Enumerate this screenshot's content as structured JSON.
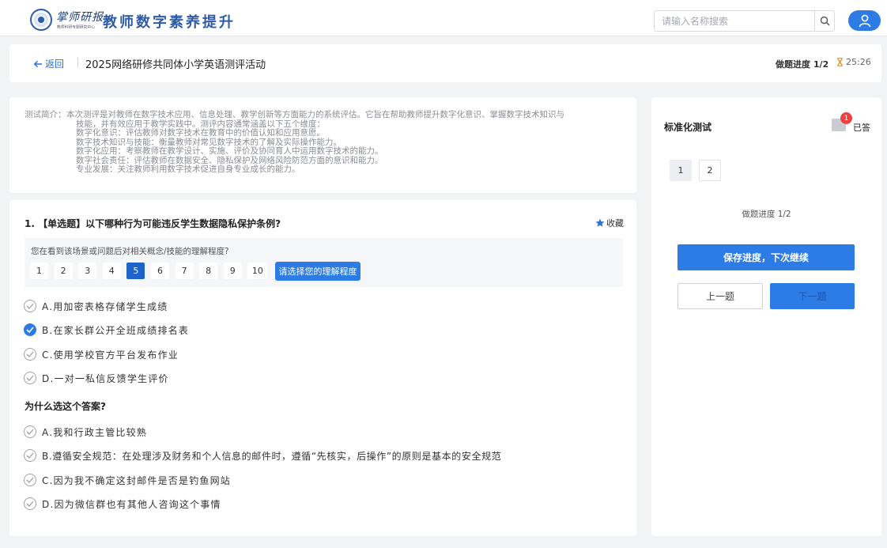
{
  "brand": {
    "logo_script": "掌师研报",
    "logo_sub": "教师科研专题研究中心",
    "title": "教师数字素养提升"
  },
  "search": {
    "placeholder": "请输入名称搜索",
    "value": ""
  },
  "header": {
    "back_label": "返回",
    "activity_title": "2025网络研修共同体小学英语测评活动",
    "progress_label": "做题进度 1/2",
    "timer": "25:26"
  },
  "intro": {
    "label": "测试简介：",
    "lines": [
      "本次测评是对教师在数字技术应用、信息处理、教学创新等方面能力的系统评估。它旨在帮助教师提升数字化意识、掌握数字技术知识与",
      "技能，并有效应用于教学实践中。测评内容通常涵盖以下五个维度：",
      "数字化意识：评估教师对数字技术在教育中的价值认知和应用意愿。",
      "数字技术知识与技能：衡量教师对常见数字技术的了解及实际操作能力。",
      "数字化应用：考察教师在教学设计、实施、评价及协同育人中运用数字技术的能力。",
      "数字社会责任：评估教师在数据安全、隐私保护及网络风险防范方面的意识和能力。",
      "专业发展：关注教师利用数字技术促进自身专业成长的能力。"
    ]
  },
  "question": {
    "title": "1. 【单选题】以下哪种行为可能违反学生数据隐私保护条例?",
    "favorite_label": "收藏",
    "scale": {
      "prompt": "您在看到该场景或问题后对相关概念/技能的理解程度?",
      "numbers": [
        "1",
        "2",
        "3",
        "4",
        "5",
        "6",
        "7",
        "8",
        "9",
        "10"
      ],
      "selected": 5,
      "hint_button": "请选择您的理解程度"
    },
    "options": [
      {
        "label": "A.用加密表格存储学生成绩",
        "checked": false
      },
      {
        "label": "B.在家长群公开全班成绩排名表",
        "checked": true
      },
      {
        "label": "C.使用学校官方平台发布作业",
        "checked": false
      },
      {
        "label": "D.一对一私信反馈学生评价",
        "checked": false
      }
    ],
    "why_title": "为什么选这个答案?",
    "why_options": [
      {
        "label": "A.我和行政主管比较熟",
        "checked": false
      },
      {
        "label": "B.遵循安全规范：在处理涉及财务和个人信息的邮件时，遵循“先核实，后操作”的原则是基本的安全规范",
        "checked": false
      },
      {
        "label": "C.因为我不确定这封邮件是否是钓鱼网站",
        "checked": false
      },
      {
        "label": "D.因为微信群也有其他人咨询这个事情",
        "checked": false
      }
    ]
  },
  "side": {
    "title": "标准化测试",
    "answered_count": "1",
    "answered_label": "已答",
    "question_numbers": [
      "1",
      "2"
    ],
    "current_question": 1,
    "progress_label": "做题进度 1/2",
    "save_button": "保存进度，下次继续",
    "prev_button": "上一题",
    "next_button": "下一题"
  },
  "colors": {
    "accent": "#2d7be5",
    "brand": "#2f5ba6",
    "badge": "#f04040",
    "page_bg": "#f2f3f5"
  },
  "icons": [
    "search-icon",
    "user-icon",
    "back-arrow-icon",
    "hourglass-icon",
    "star-icon",
    "check-circle-icon"
  ]
}
